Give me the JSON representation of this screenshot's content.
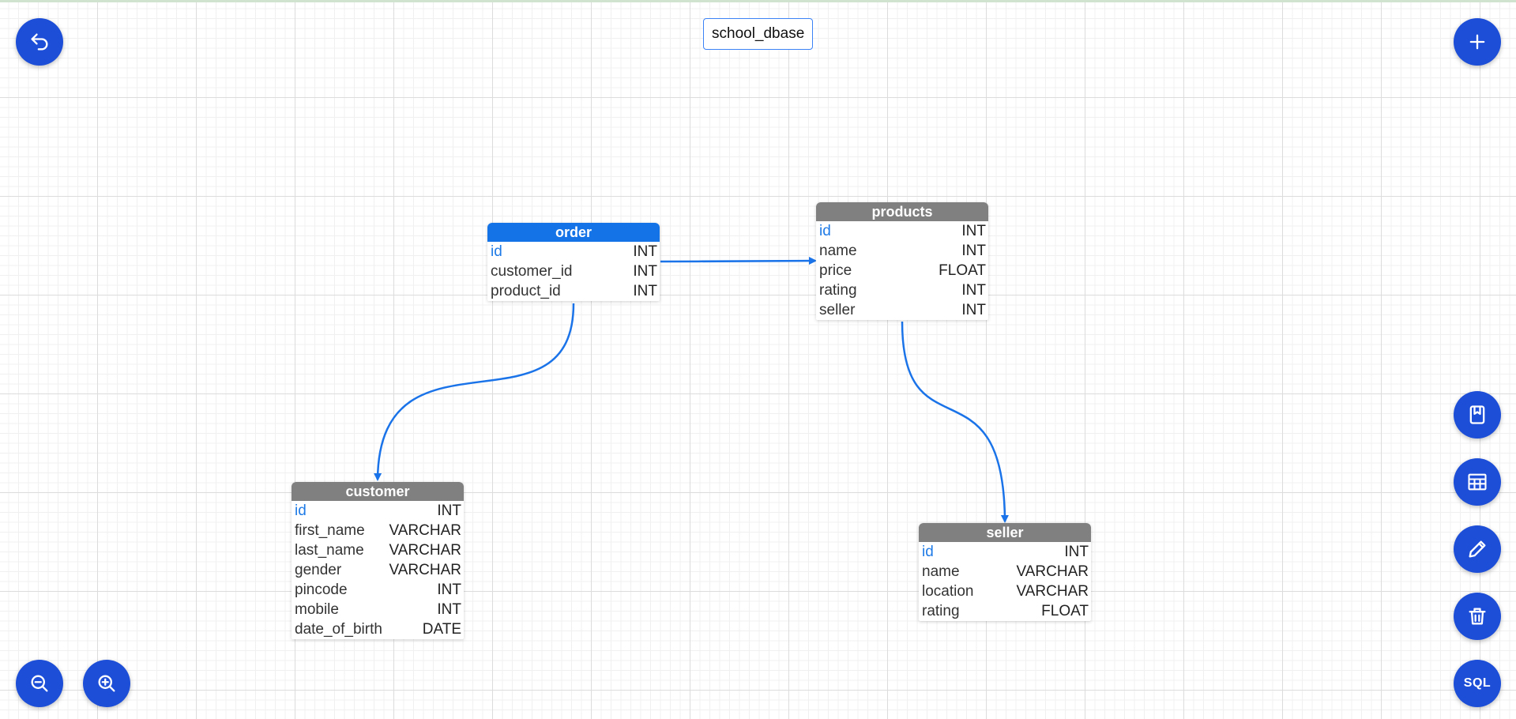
{
  "database": {
    "name": "school_dbase"
  },
  "buttons": {
    "undo": "undo-icon",
    "add": "plus-icon",
    "save": "bookmark-icon",
    "tables": "table-icon",
    "edit": "pencil-icon",
    "delete": "trash-icon",
    "sql_label": "SQL",
    "zoom_out": "zoom-out-icon",
    "zoom_in": "zoom-in-icon"
  },
  "colors": {
    "accent": "#1d4ed8",
    "selected_header": "#1473e6",
    "header": "#808080",
    "primary_key": "#1e7ae6",
    "link": "#1a73e8"
  },
  "tables": {
    "order": {
      "name": "order",
      "selected": true,
      "columns": [
        {
          "name": "id",
          "type": "INT"
        },
        {
          "name": "customer_id",
          "type": "INT"
        },
        {
          "name": "product_id",
          "type": "INT"
        }
      ]
    },
    "products": {
      "name": "products",
      "columns": [
        {
          "name": "id",
          "type": "INT"
        },
        {
          "name": "name",
          "type": "INT"
        },
        {
          "name": "price",
          "type": "FLOAT"
        },
        {
          "name": "rating",
          "type": "INT"
        },
        {
          "name": "seller",
          "type": "INT"
        }
      ]
    },
    "customer": {
      "name": "customer",
      "columns": [
        {
          "name": "id",
          "type": "INT"
        },
        {
          "name": "first_name",
          "type": "VARCHAR"
        },
        {
          "name": "last_name",
          "type": "VARCHAR"
        },
        {
          "name": "gender",
          "type": "VARCHAR"
        },
        {
          "name": "pincode",
          "type": "INT"
        },
        {
          "name": "mobile",
          "type": "INT"
        },
        {
          "name": "date_of_birth",
          "type": "DATE"
        }
      ]
    },
    "seller": {
      "name": "seller",
      "columns": [
        {
          "name": "id",
          "type": "INT"
        },
        {
          "name": "name",
          "type": "VARCHAR"
        },
        {
          "name": "location",
          "type": "VARCHAR"
        },
        {
          "name": "rating",
          "type": "FLOAT"
        }
      ]
    }
  },
  "relations": [
    {
      "from": "order.product_id",
      "to": "products.id"
    },
    {
      "from": "order.customer_id",
      "to": "customer.id"
    },
    {
      "from": "products.seller",
      "to": "seller.id"
    }
  ]
}
